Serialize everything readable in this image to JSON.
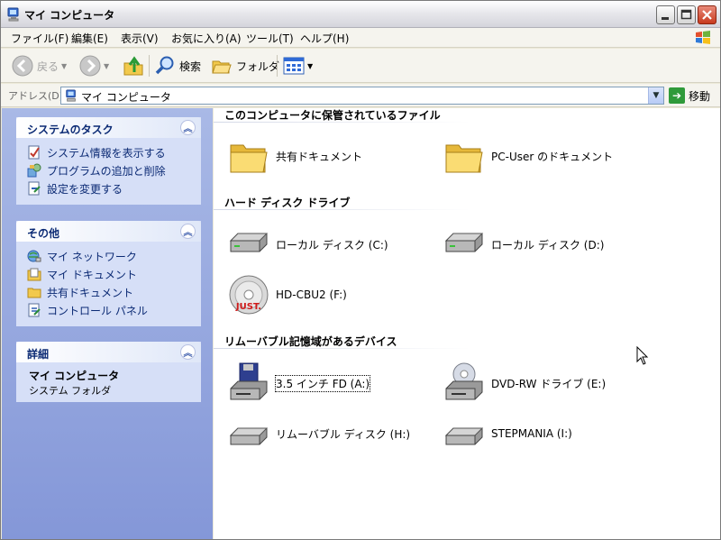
{
  "window": {
    "title": "マイ コンピュータ"
  },
  "menu": {
    "items": [
      "ファイル(F)",
      "編集(E)",
      "表示(V)",
      "お気に入り(A)",
      "ツール(T)",
      "ヘルプ(H)"
    ]
  },
  "toolbar": {
    "back_label": "戻る",
    "search_label": "検索",
    "folders_label": "フォルダ"
  },
  "address": {
    "label": "アドレス(D)",
    "value": "マイ コンピュータ",
    "go_label": "移動"
  },
  "taskpane": {
    "system_tasks": {
      "title": "システムのタスク",
      "items": [
        "システム情報を表示する",
        "プログラムの追加と削除",
        "設定を変更する"
      ]
    },
    "other_places": {
      "title": "その他",
      "items": [
        "マイ ネットワーク",
        "マイ ドキュメント",
        "共有ドキュメント",
        "コントロール パネル"
      ]
    },
    "details": {
      "title": "詳細",
      "name": "マイ コンピュータ",
      "subtitle": "システム フォルダ"
    }
  },
  "content": {
    "files_group": {
      "heading": "このコンピュータに保管されているファイル",
      "items": [
        "共有ドキュメント",
        "PC-User のドキュメント"
      ]
    },
    "hdd_group": {
      "heading": "ハード ディスク ドライブ",
      "items": [
        "ローカル ディスク (C:)",
        "ローカル ディスク (D:)",
        "HD-CBU2 (F:)"
      ]
    },
    "removable_group": {
      "heading": "リムーバブル記憶域があるデバイス",
      "items": [
        "3.5 インチ FD (A:)",
        "DVD-RW ドライブ (E:)",
        "リムーバブル ディスク (H:)",
        "STEPMANIA (I:)"
      ]
    },
    "drive_logo_text": "JUST."
  },
  "colors": {
    "taskpane_top": "#a9b9e6",
    "taskpane_bottom": "#8497d8",
    "panel_title": "#0b2a74",
    "go_green": "#2f9a3a"
  }
}
